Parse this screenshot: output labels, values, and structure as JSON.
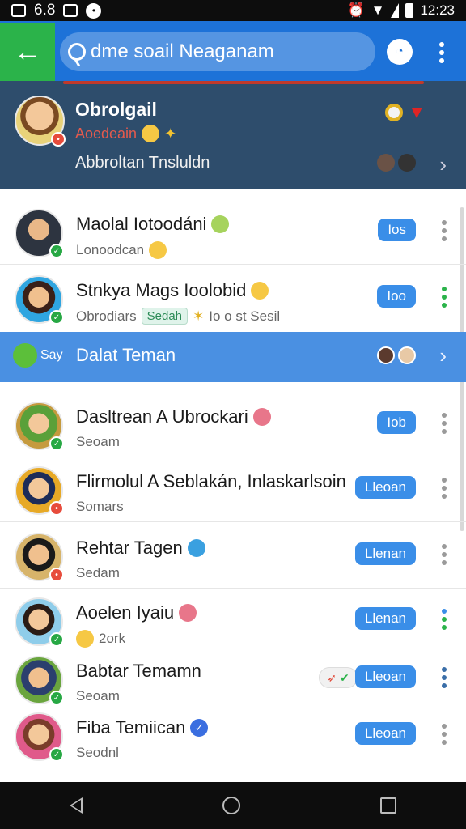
{
  "status_bar": {
    "left_text": "6.8",
    "time": "12:23"
  },
  "app_bar": {
    "search_value": "dme soail Neaganam",
    "search_placeholder": "Search",
    "back_icon": "arrow-left-icon",
    "accent": "#1d72d8",
    "back_bg": "#2bb34a"
  },
  "profile": {
    "name": "Obrolgail",
    "subtitle": "Aoedeain",
    "status": "Abbroltan Tnsluldn",
    "bg": "#2e4d6c"
  },
  "section": {
    "prefix": "Say",
    "label": "Dalat Teman",
    "bg": "#4a90e2"
  },
  "contacts": [
    {
      "name": "Maolal Iotoodáni",
      "sub": "Lonoodcan",
      "pill": "Ios",
      "badge": "green"
    },
    {
      "name": "Stnkya Mags Ioolobid",
      "sub": "Obrodiars",
      "tag": "Sedah",
      "extra": "Io o st Sesil",
      "pill": "Ioo",
      "badge": "green"
    },
    {
      "name": "Dasltrean A Ubrockari",
      "sub": "Seoam",
      "pill": "Iob",
      "badge": "green"
    },
    {
      "name": "Flirmolul A Seblakán, Inlaskarlsoin",
      "sub": "Somars",
      "pill": "Lleoan",
      "badge": "red"
    },
    {
      "name": "Rehtar Tagen",
      "sub": "Sedam",
      "pill": "Llenan",
      "badge": "red"
    },
    {
      "name": "Aoelen Iyaiu",
      "sub": "2ork",
      "pill": "Llenan",
      "badge": "green"
    },
    {
      "name": "Babtar Temamn",
      "sub": "Seoam",
      "pill": "Lleoan",
      "badge": "green"
    },
    {
      "name": "Fiba Temiican",
      "sub": "Seodnl",
      "pill": "Lleoan",
      "badge": "green"
    }
  ]
}
